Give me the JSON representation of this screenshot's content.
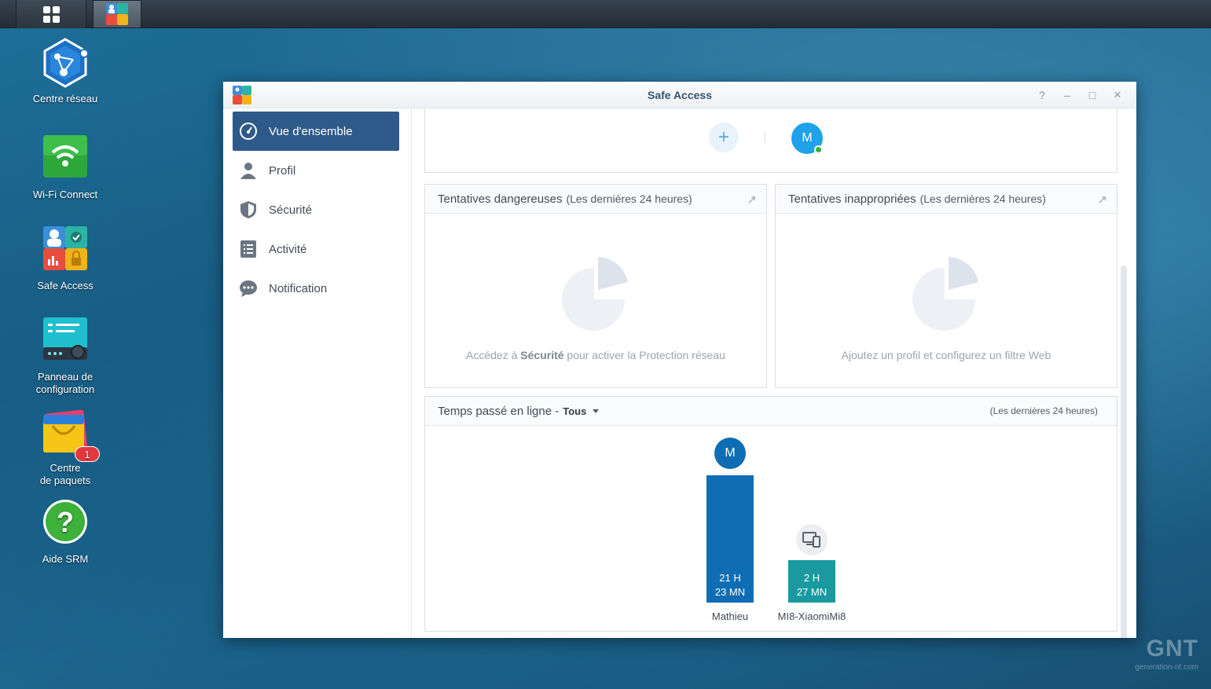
{
  "desktop": {
    "icons": [
      {
        "label": "Centre réseau",
        "icon": "network-center-icon"
      },
      {
        "label": "Wi-Fi Connect",
        "icon": "wifi-icon"
      },
      {
        "label": "Safe Access",
        "icon": "safe-access-icon"
      },
      {
        "label": "Panneau de\nconfiguration",
        "icon": "control-panel-icon"
      },
      {
        "label": "Centre\nde paquets",
        "icon": "package-center-icon",
        "badge": "1"
      },
      {
        "label": "Aide SRM",
        "icon": "help-icon"
      }
    ],
    "watermark": "GNT",
    "watermark_sub": "generation-nt.com"
  },
  "window": {
    "title": "Safe Access",
    "controls": [
      "?",
      "–",
      "□",
      "×"
    ]
  },
  "sidebar": {
    "items": [
      {
        "label": "Vue d'ensemble",
        "icon": "dashboard-icon",
        "active": true
      },
      {
        "label": "Profil",
        "icon": "user-icon"
      },
      {
        "label": "Sécurité",
        "icon": "shield-icon"
      },
      {
        "label": "Activité",
        "icon": "list-icon"
      },
      {
        "label": "Notification",
        "icon": "chat-bubble-icon"
      }
    ]
  },
  "profiles_strip": {
    "add_label": "+",
    "profile_initial": "M"
  },
  "dangerous": {
    "title": "Tentatives dangereuses",
    "subtitle": "(Les dernières 24 heures)",
    "msg_pre": "Accédez à ",
    "msg_bold": "Sécurité",
    "msg_post": " pour activer la Protection réseau"
  },
  "inappropriate": {
    "title": "Tentatives inappropriées",
    "subtitle": "(Les dernières 24 heures)",
    "msg": "Ajoutez un profil et configurez un filtre Web"
  },
  "online_time": {
    "title": "Temps passé en ligne -",
    "filter": "Tous",
    "period": "(Les dernières 24 heures)",
    "entries": [
      {
        "name": "Mathieu",
        "initial": "M",
        "hours_label": "21 H",
        "minutes_label": "23 MN",
        "hours": 21.38,
        "color": "#0f6db3",
        "icon": "avatar"
      },
      {
        "name": "MI8-XiaomiMi8",
        "initial": "",
        "hours_label": "2 H",
        "minutes_label": "27 MN",
        "hours": 2.45,
        "color": "#1a9aa0",
        "icon": "devices-icon"
      }
    ]
  }
}
